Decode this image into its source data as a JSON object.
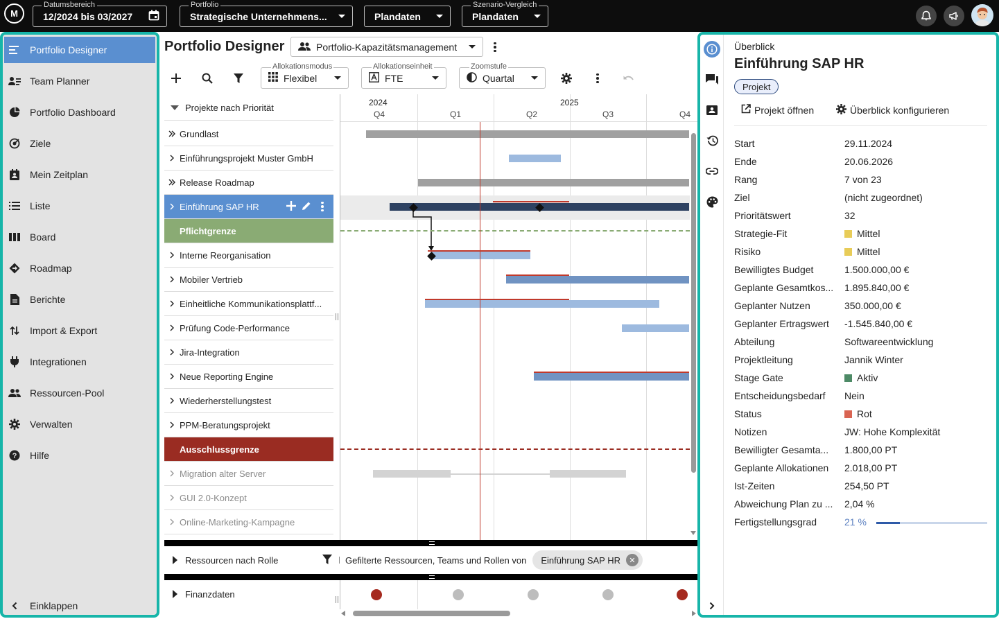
{
  "topbar": {
    "logo_text": "M",
    "date_range": {
      "legend": "Datumsbereich",
      "value": "12/2024 bis 03/2027"
    },
    "portfolio": {
      "legend": "Portfolio",
      "value": "Strategische Unternehmens..."
    },
    "plandaten": {
      "value": "Plandaten"
    },
    "scenario": {
      "legend": "Szenario-Vergleich",
      "value": "Plandaten"
    }
  },
  "sidebar": {
    "items": [
      {
        "label": "Portfolio Designer",
        "icon": "designer-icon"
      },
      {
        "label": "Team Planner",
        "icon": "team-planner-icon"
      },
      {
        "label": "Portfolio Dashboard",
        "icon": "dashboard-icon"
      },
      {
        "label": "Ziele",
        "icon": "goals-icon"
      },
      {
        "label": "Mein Zeitplan",
        "icon": "schedule-icon"
      },
      {
        "label": "Liste",
        "icon": "list-icon"
      },
      {
        "label": "Board",
        "icon": "board-icon"
      },
      {
        "label": "Roadmap",
        "icon": "roadmap-icon"
      },
      {
        "label": "Berichte",
        "icon": "reports-icon"
      },
      {
        "label": "Import & Export",
        "icon": "import-export-icon"
      },
      {
        "label": "Integrationen",
        "icon": "plug-icon"
      },
      {
        "label": "Ressourcen-Pool",
        "icon": "people-icon"
      },
      {
        "label": "Verwalten",
        "icon": "gear-icon"
      },
      {
        "label": "Hilfe",
        "icon": "help-icon"
      }
    ],
    "collapse_label": "Einklappen"
  },
  "main": {
    "title": "Portfolio Designer",
    "view_select": "Portfolio-Kapazitätsmanagement",
    "toolbar": {
      "alloc_mode": {
        "legend": "Allokationsmodus",
        "value": "Flexibel"
      },
      "alloc_unit": {
        "legend": "Allokationseinheit",
        "value": "FTE"
      },
      "zoom": {
        "legend": "Zoomstufe",
        "value": "Quartal"
      }
    },
    "list_header": "Projekte nach Priorität",
    "projects": [
      {
        "label": "Grundlast"
      },
      {
        "label": "Einführungsprojekt Muster GmbH"
      },
      {
        "label": "Release Roadmap"
      },
      {
        "label": "Einführung SAP HR"
      },
      {
        "label": "Pflichtgrenze"
      },
      {
        "label": "Interne Reorganisation"
      },
      {
        "label": "Mobiler Vertrieb"
      },
      {
        "label": "Einheitliche Kommunikationsplattf..."
      },
      {
        "label": "Prüfung Code-Performance"
      },
      {
        "label": "Jira-Integration"
      },
      {
        "label": "Neue Reporting Engine"
      },
      {
        "label": "Wiederherstellungstest"
      },
      {
        "label": "PPM-Beratungsprojekt"
      },
      {
        "label": "Ausschlussgrenze"
      },
      {
        "label": "Migration alter Server"
      },
      {
        "label": "GUI 2.0-Konzept"
      },
      {
        "label": "Online-Marketing-Kampagne"
      }
    ],
    "timeline": {
      "years": [
        "2024",
        "2025"
      ],
      "quarters": [
        "Q4",
        "Q1",
        "Q2",
        "Q3",
        "Q4"
      ]
    },
    "resources": {
      "label": "Ressourcen nach Rolle",
      "filter_text": "Gefilterte Ressourcen, Teams und Rollen von",
      "chip": "Einführung SAP HR"
    },
    "finance": {
      "label": "Finanzdaten"
    }
  },
  "colors": {
    "accent_teal": "#17b5a9",
    "selected_blue": "#5a8fd0",
    "dark_bar": "#2e4262",
    "light_bar": "#9dbadf",
    "mid_bar": "#7093c2",
    "gray_bar": "#a0a0a0",
    "required_line": "#8aab74",
    "exclusion_line": "#9a2c22",
    "status_yellow": "#e8cc58",
    "status_green": "#4d8a66",
    "status_red": "#d96452"
  },
  "panel": {
    "kicker": "Überblick",
    "title": "Einführung SAP HR",
    "type_pill": "Projekt",
    "action_open": "Projekt öffnen",
    "action_configure": "Überblick konfigurieren",
    "rows": [
      {
        "key": "Start",
        "value": "29.11.2024"
      },
      {
        "key": "Ende",
        "value": "20.06.2026"
      },
      {
        "key": "Rang",
        "value": "7 von 23"
      },
      {
        "key": "Ziel",
        "value": "(nicht zugeordnet)"
      },
      {
        "key": "Prioritätswert",
        "value": "32"
      },
      {
        "key": "Strategie-Fit",
        "value": "Mittel"
      },
      {
        "key": "Risiko",
        "value": "Mittel"
      },
      {
        "key": "Bewilligtes Budget",
        "value": "1.500.000,00 €"
      },
      {
        "key": "Geplante Gesamtkos...",
        "value": "1.895.840,00 €"
      },
      {
        "key": "Geplanter Nutzen",
        "value": "350.000,00 €"
      },
      {
        "key": "Geplanter Ertragswert",
        "value": "-1.545.840,00 €"
      },
      {
        "key": "Abteilung",
        "value": "Softwareentwicklung"
      },
      {
        "key": "Projektleitung",
        "value": "Jannik Winter"
      },
      {
        "key": "Stage Gate",
        "value": "Aktiv"
      },
      {
        "key": "Entscheidungsbedarf",
        "value": "Nein"
      },
      {
        "key": "Status",
        "value": "Rot"
      },
      {
        "key": "Notizen",
        "value": "JW: Hohe Komplexität"
      },
      {
        "key": "Bewilligter Gesamta...",
        "value": "1.800,00 PT"
      },
      {
        "key": "Geplante Allokationen",
        "value": "2.018,00 PT"
      },
      {
        "key": "Ist-Zeiten",
        "value": "254,50 PT"
      },
      {
        "key": "Abweichung Plan zu ...",
        "value": "2,04 %"
      },
      {
        "key": "Fertigstellungsgrad",
        "value": "21 %"
      }
    ],
    "completion_fraction": 0.21
  }
}
